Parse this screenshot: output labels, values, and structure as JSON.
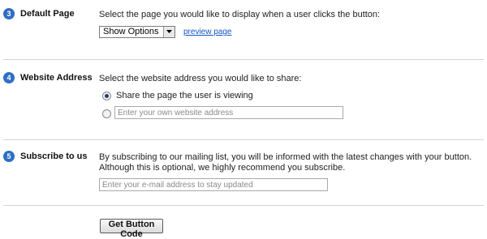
{
  "steps": {
    "default_page": {
      "number": "3",
      "title": "Default Page",
      "description": "Select the page you would like to display when a user clicks the button:",
      "select_value": "Show Options",
      "preview_link": "preview page"
    },
    "website_address": {
      "number": "4",
      "title": "Website Address",
      "description": "Select the website address you would like to share:",
      "option_current": "Share the page the user is viewing",
      "option_current_selected": true,
      "custom_placeholder": "Enter your own website address"
    },
    "subscribe": {
      "number": "5",
      "title": "Subscribe to us",
      "description_line1": "By subscribing to our mailing list, you will be informed with the latest changes with your button.",
      "description_line2": "Although this is optional, we highly recommend you subscribe.",
      "email_placeholder": "Enter your e-mail address to stay updated"
    }
  },
  "actions": {
    "get_code_label": "Get Button Code"
  },
  "colors": {
    "badge": "#2e6fc4",
    "link": "#1155cc",
    "divider": "#d4d4d4"
  }
}
